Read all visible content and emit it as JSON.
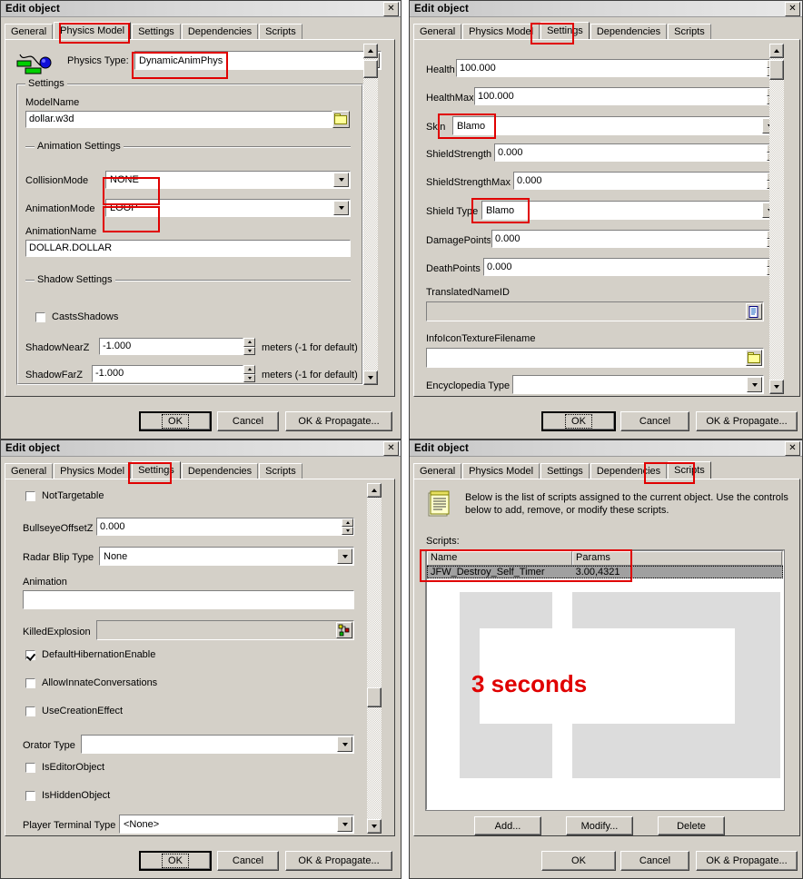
{
  "common": {
    "window_title": "Edit object",
    "close_label": "✕",
    "tabs": [
      "General",
      "Physics Model",
      "Settings",
      "Dependencies",
      "Scripts"
    ],
    "ok": "OK",
    "cancel": "Cancel",
    "ok_propagate": "OK & Propagate..."
  },
  "panel1": {
    "title": "Edit object",
    "active_tab": "Physics Model",
    "tabs": [
      "General",
      "Physics Model",
      "Settings",
      "Dependencies",
      "Scripts"
    ],
    "physics_icon": "physics-ball-curve-icon",
    "physics_type_label": "Physics Type:",
    "physics_type_value": "DynamicAnimPhys",
    "settings_group": "Settings",
    "modelname_label": "ModelName",
    "modelname_value": "dollar.w3d",
    "modelname_browse_icon": "folder-icon",
    "animation_group": "Animation Settings",
    "collisionmode_label": "CollisionMode",
    "collisionmode_value": "NONE",
    "animationmode_label": "AnimationMode",
    "animationmode_value": "LOOP",
    "animationname_label": "AnimationName",
    "animationname_value": "DOLLAR.DOLLAR",
    "shadow_group": "Shadow Settings",
    "castsshadows_label": "CastsShadows",
    "castsshadows_checked": false,
    "shadownearz_label": "ShadowNearZ",
    "shadownearz_value": "-1.000",
    "shadownearz_suffix": "meters (-1 for default)",
    "shadowfarz_label": "ShadowFarZ",
    "shadowfarz_value": "-1.000",
    "shadowfarz_suffix": "meters (-1 for default)",
    "ok": "OK",
    "cancel": "Cancel",
    "ok_propagate": "OK & Propagate..."
  },
  "panel2": {
    "title": "Edit object",
    "active_tab": "Settings",
    "tabs": [
      "General",
      "Physics Model",
      "Settings",
      "Dependencies",
      "Scripts"
    ],
    "health_label": "Health",
    "health_value": "100.000",
    "healthmax_label": "HealthMax",
    "healthmax_value": "100.000",
    "skin_label": "Skin",
    "skin_value": "Blamo",
    "shieldstrength_label": "ShieldStrength",
    "shieldstrength_value": "0.000",
    "shieldstrengthmax_label": "ShieldStrengthMax",
    "shieldstrengthmax_value": "0.000",
    "shieldtype_label": "Shield Type",
    "shieldtype_value": "Blamo",
    "damagepoints_label": "DamagePoints",
    "damagepoints_value": "0.000",
    "deathpoints_label": "DeathPoints",
    "deathpoints_value": "0.000",
    "translatednameid_label": "TranslatedNameID",
    "translatednameid_value": "",
    "translatednameid_icon": "document-icon",
    "infoicon_label": "InfoIconTextureFilename",
    "infoicon_value": "",
    "infoicon_browse_icon": "folder-icon",
    "encyclopedia_label": "Encyclopedia Type",
    "encyclopedia_value": "",
    "ok": "OK",
    "cancel": "Cancel",
    "ok_propagate": "OK & Propagate..."
  },
  "panel3": {
    "title": "Edit object",
    "active_tab": "Settings",
    "tabs": [
      "General",
      "Physics Model",
      "Settings",
      "Dependencies",
      "Scripts"
    ],
    "nottargetable_label": "NotTargetable",
    "nottargetable_checked": false,
    "bullseye_label": "BullseyeOffsetZ",
    "bullseye_value": "0.000",
    "radarblip_label": "Radar Blip Type",
    "radarblip_value": "None",
    "animation_label": "Animation",
    "animation_value": "",
    "killedexplosion_label": "KilledExplosion",
    "killedexplosion_value": "",
    "killedexplosion_icon": "hierarchy-picker-icon",
    "defaulthibernation_label": "DefaultHibernationEnable",
    "defaulthibernation_checked": true,
    "allowinnate_label": "AllowInnateConversations",
    "allowinnate_checked": false,
    "usecreation_label": "UseCreationEffect",
    "usecreation_checked": false,
    "orator_label": "Orator Type",
    "orator_value": "",
    "iseditorobject_label": "IsEditorObject",
    "iseditorobject_checked": false,
    "ishiddenobject_label": "IsHiddenObject",
    "ishiddenobject_checked": false,
    "playerterminal_label": "Player Terminal Type",
    "playerterminal_value": "<None>",
    "ok": "OK",
    "cancel": "Cancel",
    "ok_propagate": "OK & Propagate..."
  },
  "panel4": {
    "title": "Edit object",
    "active_tab": "Scripts",
    "tabs": [
      "General",
      "Physics Model",
      "Settings",
      "Dependencies",
      "Scripts"
    ],
    "info_icon": "script-document-icon",
    "info_text": "Below is the list of scripts assigned to the current object.  Use the controls below to add, remove, or modify these scripts.",
    "scripts_label": "Scripts:",
    "columns": [
      "Name",
      "Params"
    ],
    "rows": [
      {
        "name": "JFW_Destroy_Self_Timer",
        "params": "3.00,4321"
      }
    ],
    "annotation": "3 seconds",
    "add": "Add...",
    "modify": "Modify...",
    "delete": "Delete",
    "ok": "OK",
    "cancel": "Cancel",
    "ok_propagate": "OK & Propagate..."
  },
  "colors": {
    "highlight": "#e00000",
    "face": "#d4d0c8",
    "selection": "#a0a0a0"
  }
}
